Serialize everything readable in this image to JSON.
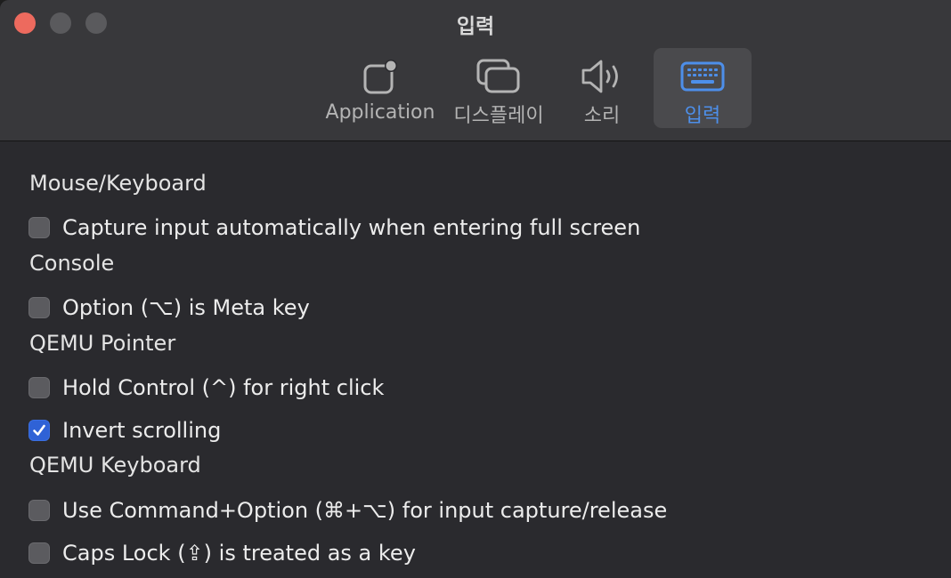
{
  "window": {
    "title": "입력"
  },
  "tabs": [
    {
      "label": "Application",
      "icon": "application-icon"
    },
    {
      "label": "디스플레이",
      "icon": "display-icon"
    },
    {
      "label": "소리",
      "icon": "speaker-icon"
    },
    {
      "label": "입력",
      "icon": "keyboard-icon",
      "active": true
    }
  ],
  "sections": {
    "mouse_keyboard": {
      "title": "Mouse/Keyboard",
      "options": [
        {
          "label": "Capture input automatically when entering full screen",
          "checked": false
        }
      ]
    },
    "console": {
      "title": "Console",
      "options": [
        {
          "label": "Option (⌥) is Meta key",
          "checked": false
        }
      ]
    },
    "qemu_pointer": {
      "title": "QEMU Pointer",
      "options": [
        {
          "label": "Hold Control (^) for right click",
          "checked": false
        },
        {
          "label": "Invert scrolling",
          "checked": true
        }
      ]
    },
    "qemu_keyboard": {
      "title": "QEMU Keyboard",
      "options": [
        {
          "label": "Use Command+Option (⌘+⌥) for input capture/release",
          "checked": false
        },
        {
          "label": "Caps Lock (⇪) is treated as a key",
          "checked": false
        }
      ]
    }
  },
  "colors": {
    "accent": "#4d8fea",
    "checkbox_checked": "#2f62d6",
    "close_button": "#ed6a5e"
  }
}
